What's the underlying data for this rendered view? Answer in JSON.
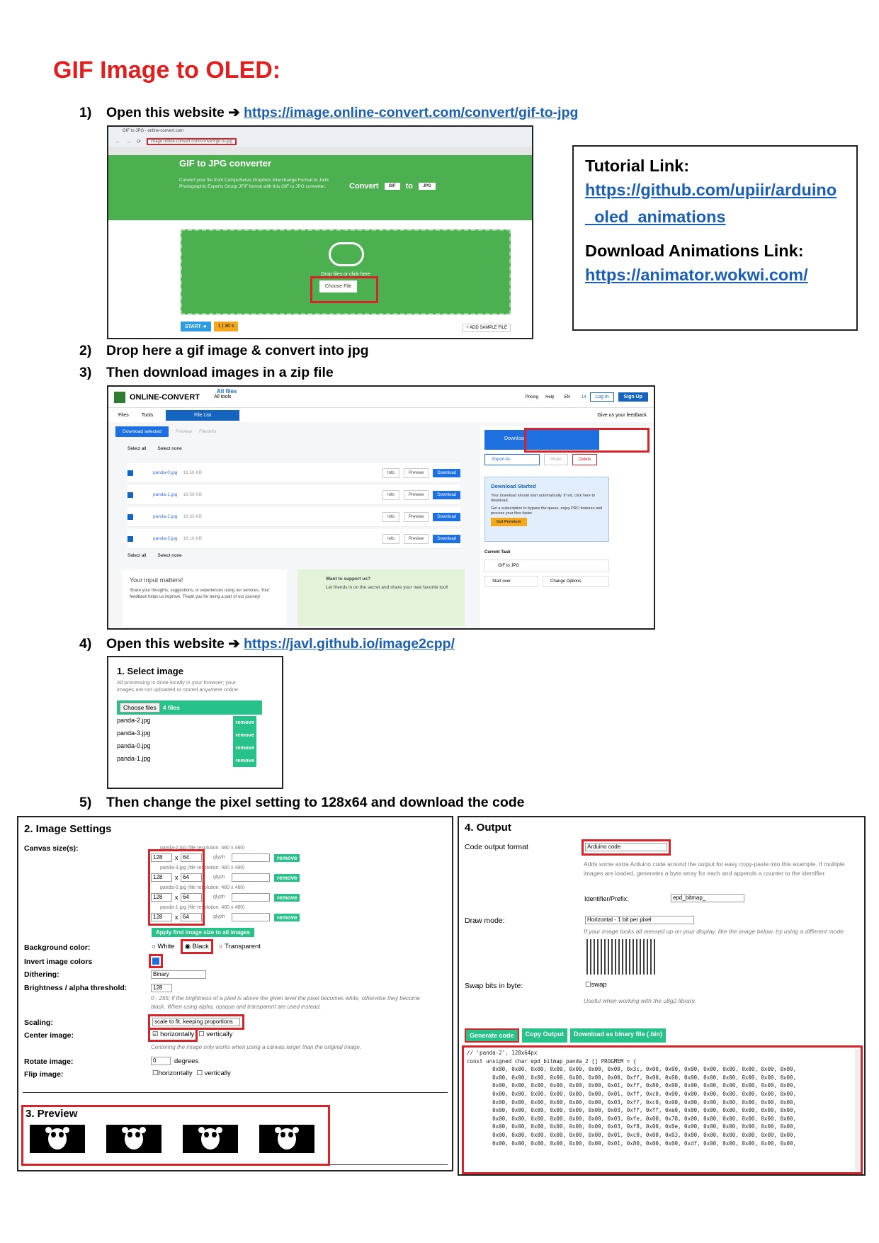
{
  "title": "GIF Image to OLED:",
  "steps": [
    {
      "num": "1)",
      "text": "Open this website ",
      "arrow": "➔",
      "link": "https://image.online-convert.com/convert/gif-to-jpg"
    },
    {
      "num": "2)",
      "text": "Drop here a gif image & convert into jpg"
    },
    {
      "num": "3)",
      "text": "Then download images in a zip file"
    },
    {
      "num": "4)",
      "text": "Open this website ",
      "arrow": "➔",
      "link": "https://javl.github.io/image2cpp/"
    },
    {
      "num": "5)",
      "text": "Then change the pixel setting to 128x64 and download the code"
    }
  ],
  "links": {
    "tutorial_label": "Tutorial Link:",
    "tutorial_url": "https://github.com/upiir/arduino_oled_animations",
    "download_label": "Download Animations Link:",
    "download_url": "https://animator.wokwi.com/"
  },
  "shot1": {
    "tab": "GIF to JPG - online-convert.com",
    "url": "image.online-convert.com/convert/gif-to-jpg",
    "heading": "GIF to JPG converter",
    "desc": "Convert your file from CompuServe Graphics Interchange Format to Joint Photographic Experts Group JFIF format with this GIF to JPG converter.",
    "convert": "Convert",
    "from": "GIF",
    "to_word": "to",
    "to": "JPG",
    "drop": "Drop files or click here",
    "choose": "Choose File",
    "start": "START ➔",
    "opts": "1 | 30 s",
    "sample": "+ ADD SAMPLE FILE"
  },
  "shot2": {
    "logo": "ONLINE-CONVERT",
    "alltools": "All tools",
    "pricing": "Pricing",
    "help": "Help",
    "lang": "EN",
    "credits": "14",
    "login": "Log in",
    "signup": "Sign Up",
    "tab_files": "Files",
    "tab_tools": "Tools",
    "tab_filelist": "File List",
    "feedback": "Give us your feedback",
    "dl_selected": "Download selected",
    "preview": "Preview",
    "filesinfo": "Filesinfo",
    "select_all": "Select all",
    "select_none": "Select none",
    "files": [
      {
        "name": "panda-0.jpg",
        "size": "18.56 KB"
      },
      {
        "name": "panda-1.jpg",
        "size": "18.58 KB"
      },
      {
        "name": "panda-2.jpg",
        "size": "19.33 KB"
      },
      {
        "name": "panda-3.jpg",
        "size": "18.18 KB"
      }
    ],
    "info": "Info",
    "preview_btn": "Preview",
    "download_btn": "Download",
    "download_main": "Download",
    "export": "Export As",
    "share": "Share",
    "delete": "Delete",
    "started_title": "Download Started",
    "allfiles": "All files",
    "started_text": "Your download should start automatically. If not, click here to download.",
    "sub_text": "Get a subscription to bypass the queue, enjoy PRO features and process your files faster.",
    "premium": "Got Premium",
    "input_title": "Your input matters!",
    "input_text": "Share your thoughts, suggestions, or experiences using our services. Your feedback helps us improve. Thank you for being a part of our journey!",
    "support_title": "Want to support us?",
    "support_text": "Let friends in on the secret and share your new favorite tool!",
    "current_task": "Current Task",
    "task": "GIF to JPG",
    "start_over": "Start over",
    "change": "Change Options"
  },
  "shot4": {
    "heading": "1. Select image",
    "desc": "All processing is done locally in your browser; your images are not uploaded or stored anywhere online.",
    "choose": "Choose files",
    "count": "4 files",
    "files": [
      "panda-2.jpg",
      "panda-3.jpg",
      "panda-0.jpg",
      "panda-1.jpg"
    ],
    "remove": "remove"
  },
  "shot5": {
    "heading": "2. Image Settings",
    "canvas_label": "Canvas size(s):",
    "canvas": [
      {
        "file": "panda-2.jpg (file resolution: 480 x 480)",
        "w": "128",
        "h": "64"
      },
      {
        "file": "panda-3.jpg (file resolution: 480 x 480)",
        "w": "128",
        "h": "64"
      },
      {
        "file": "panda-0.jpg (file resolution: 480 x 480)",
        "w": "128",
        "h": "64"
      },
      {
        "file": "panda-1.jpg (file resolution: 480 x 480)",
        "w": "128",
        "h": "64"
      }
    ],
    "x": "x",
    "glyph": "glyph",
    "remove": "remove",
    "apply": "Apply first image size to all images",
    "bg_label": "Background color:",
    "white": "White",
    "black": "Black",
    "transparent": "Transparent",
    "invert_label": "Invert image colors",
    "dither_label": "Dithering:",
    "dither": "Binary",
    "bright_label": "Brightness / alpha threshold:",
    "bright": "128",
    "bright_help": "0 - 255; if the brightness of a pixel is above the given level the pixel becomes white, otherwise they become black. When using alpha, opaque and transparent are used instead.",
    "scale_label": "Scaling:",
    "scale": "scale to fit, keeping proportions",
    "center_label": "Center image:",
    "horiz": "horizontally",
    "vert": "vertically",
    "center_help": "Centering the image only works when using a canvas larger than the original image.",
    "rotate_label": "Rotate image:",
    "rotate": "0",
    "degrees": "degrees",
    "flip_label": "Flip image:",
    "preview_heading": "3. Preview"
  },
  "shot6": {
    "heading": "4. Output",
    "format_label": "Code output format",
    "format": "Arduino code",
    "format_help": "Adds some extra Arduino code around the output for easy copy-paste into this example. If multiple images are loaded, generates a byte array for each and appends a counter to the identifier.",
    "ident_label": "Identifier/Prefix:",
    "ident": "epd_bitmap_",
    "draw_label": "Draw mode:",
    "draw": "Horizontal - 1 bit per pixel",
    "draw_help": "If your image looks all messed up on your display, like the image below, try using a different mode.",
    "swap_label": "Swap bits in byte:",
    "swap": "swap",
    "swap_help": "Useful when working with the u8g2 library.",
    "generate": "Generate code",
    "copy": "Copy Output",
    "download_bin": "Download as binary file (.bin)",
    "code": [
      "// 'panda-2', 128x64px",
      "const unsigned char epd_bitmap_panda_2 [] PROGMEM = {",
      "\t0x00, 0x00, 0x00, 0x00, 0x00, 0x00, 0x00, 0x3c, 0x00, 0x00, 0x00, 0x00, 0x00, 0x00, 0x00, 0x00,",
      "\t0x00, 0x00, 0x00, 0x00, 0x00, 0x00, 0x00, 0xff, 0x00, 0x00, 0x00, 0x00, 0x00, 0x00, 0x00, 0x00,",
      "\t0x00, 0x00, 0x00, 0x00, 0x00, 0x00, 0x01, 0xff, 0x80, 0x00, 0x00, 0x00, 0x00, 0x00, 0x00, 0x00,",
      "\t0x00, 0x00, 0x00, 0x00, 0x00, 0x00, 0x01, 0xff, 0xc0, 0x00, 0x00, 0x00, 0x00, 0x00, 0x00, 0x00,",
      "\t0x00, 0x00, 0x00, 0x00, 0x00, 0x00, 0x03, 0xff, 0xc0, 0x00, 0x00, 0x00, 0x00, 0x00, 0x00, 0x00,",
      "\t0x00, 0x00, 0x00, 0x00, 0x00, 0x00, 0x03, 0xff, 0xff, 0xe0, 0x00, 0x00, 0x00, 0x00, 0x00, 0x00,",
      "\t0x00, 0x00, 0x00, 0x00, 0x00, 0x00, 0x03, 0xfe, 0x00, 0x78, 0x00, 0x00, 0x00, 0x00, 0x00, 0x00,",
      "\t0x00, 0x00, 0x00, 0x00, 0x00, 0x00, 0x03, 0xf8, 0x00, 0x0e, 0x00, 0x00, 0x00, 0x00, 0x00, 0x00,",
      "\t0x00, 0x00, 0x00, 0x00, 0x00, 0x00, 0x01, 0xc0, 0x00, 0x03, 0x80, 0x00, 0x00, 0x00, 0x00, 0x00,",
      "\t0x00, 0x00, 0x00, 0x00, 0x00, 0x00, 0x01, 0x80, 0x00, 0x00, 0xdf, 0x00, 0x00, 0x00, 0x00, 0x00,"
    ]
  },
  "colors": {
    "accent_red": "#d8232a",
    "link": "#1a5fb4",
    "green": "#4caf50",
    "teal": "#27c28a",
    "blue": "#1565c0"
  }
}
